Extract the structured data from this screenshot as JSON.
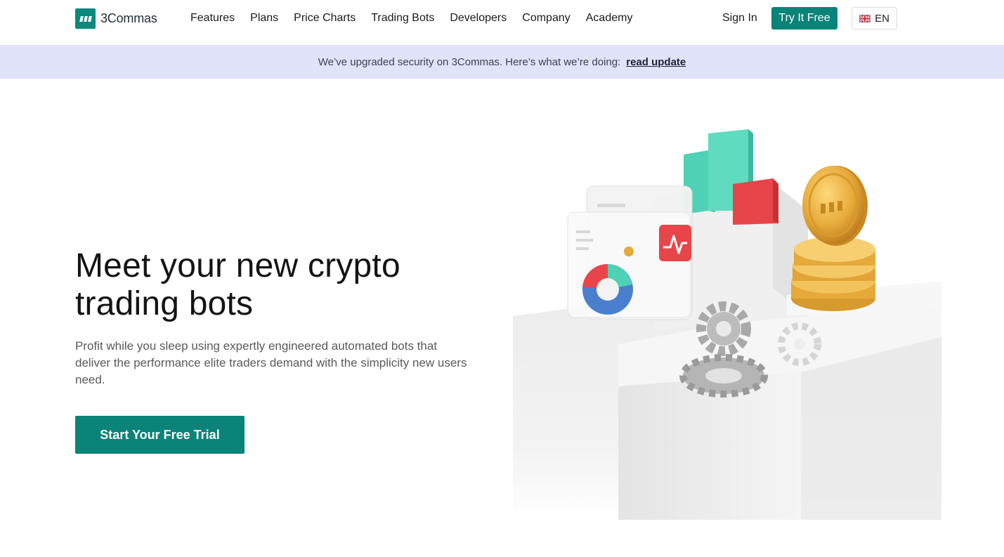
{
  "header": {
    "logo_text": "3Commas",
    "nav": [
      "Features",
      "Plans",
      "Price Charts",
      "Trading Bots",
      "Developers",
      "Company",
      "Academy"
    ],
    "sign_in": "Sign In",
    "try_free": "Try It Free",
    "language": "EN"
  },
  "banner": {
    "text": "We’ve upgraded security on 3Commas. Here’s what we’re doing:",
    "link": "read update"
  },
  "hero": {
    "title": "Meet your new crypto trading bots",
    "subtitle": "Profit while you sleep using expertly engineered automated bots that deliver the performance elite traders demand with the simplicity new users need.",
    "cta": "Start Your Free Trial"
  },
  "colors": {
    "brand": "#0a8378",
    "banner_bg": "#e0e3fa",
    "bar_green": "#4fd1b5",
    "bar_red": "#e8454a",
    "coin_gold": "#e6a93a"
  },
  "icons": [
    "logo-icon",
    "uk-flag-icon",
    "chart-bars-icon",
    "gear-icon",
    "coin-stack-icon",
    "pie-chart-icon",
    "pulse-icon"
  ]
}
